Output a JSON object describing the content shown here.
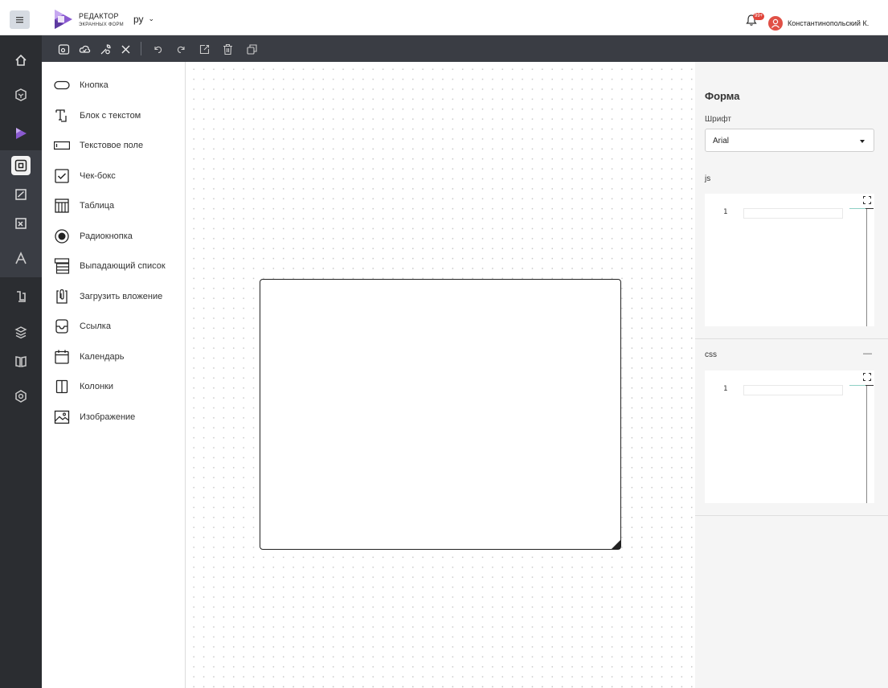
{
  "header": {
    "menu_icon": "hamburger-icon",
    "logo_line1": "РЕДАКТОР",
    "logo_line2": "ЭКРАННЫХ ФОРМ",
    "language": "ру",
    "notification_badge": "99+",
    "username": "Константинопольский К."
  },
  "toolbar": {
    "buttons": [
      "preview-icon",
      "cloud-save-icon",
      "settings-tool-icon",
      "close-icon",
      "undo-icon",
      "redo-icon",
      "export-icon",
      "trash-icon",
      "copy-icon"
    ]
  },
  "palette": {
    "items": [
      {
        "label": "Кнопка",
        "icon": "button-shape-icon"
      },
      {
        "label": "Блок с текстом",
        "icon": "text-block-icon"
      },
      {
        "label": "Текстовое поле",
        "icon": "text-field-icon"
      },
      {
        "label": "Чек-бокс",
        "icon": "checkbox-icon"
      },
      {
        "label": "Таблица",
        "icon": "table-icon"
      },
      {
        "label": "Радиокнопка",
        "icon": "radio-icon"
      },
      {
        "label": "Выпадающий список",
        "icon": "dropdown-list-icon"
      },
      {
        "label": "Загрузить вложение",
        "icon": "attachment-icon"
      },
      {
        "label": "Ссылка",
        "icon": "link-icon"
      },
      {
        "label": "Календарь",
        "icon": "calendar-icon"
      },
      {
        "label": "Колонки",
        "icon": "columns-icon"
      },
      {
        "label": "Изображение",
        "icon": "image-icon"
      }
    ]
  },
  "properties": {
    "title": "Форма",
    "font_label": "Шрифт",
    "font_value": "Arial",
    "js_label": "js",
    "js_line_number": "1",
    "css_label": "css",
    "css_line_number": "1",
    "collapse_symbol": "—"
  },
  "colors": {
    "rail_bg": "#2b2d31",
    "toolbar_bg": "#3a3d44",
    "accent_logo": "#7a4fc4",
    "badge": "#e0443a"
  }
}
